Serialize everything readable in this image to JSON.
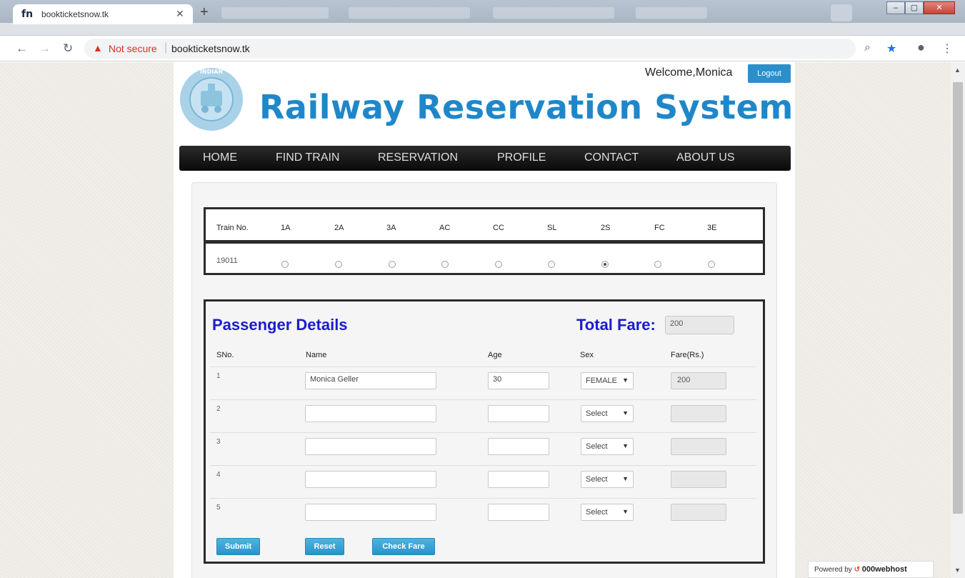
{
  "browser": {
    "tab_title": "bookticketsnow.tk",
    "tab_favicon": "fn",
    "not_secure": "Not secure",
    "url": "bookticketsnow.tk"
  },
  "header": {
    "welcome": "Welcome,Monica",
    "logout": "Logout",
    "title": "Railway Reservation System",
    "logo_text": "INDIAN RAILWAYS"
  },
  "nav": [
    "HOME",
    "FIND TRAIN",
    "RESERVATION",
    "PROFILE",
    "CONTACT",
    "ABOUT US"
  ],
  "train_table": {
    "headers": [
      "Train No.",
      "1A",
      "2A",
      "3A",
      "AC",
      "CC",
      "SL",
      "2S",
      "FC",
      "3E"
    ],
    "train_no": "19011",
    "selected_class": "2S"
  },
  "passenger": {
    "title": "Passenger Details",
    "total_fare_label": "Total Fare:",
    "total_fare": "200",
    "columns": [
      "SNo.",
      "Name",
      "Age",
      "Sex",
      "Fare(Rs.)"
    ],
    "rows": [
      {
        "sno": "1",
        "name": "Monica Geller",
        "age": "30",
        "sex": "FEMALE",
        "fare": "200"
      },
      {
        "sno": "2",
        "name": "",
        "age": "",
        "sex": "Select",
        "fare": ""
      },
      {
        "sno": "3",
        "name": "",
        "age": "",
        "sex": "Select",
        "fare": ""
      },
      {
        "sno": "4",
        "name": "",
        "age": "",
        "sex": "Select",
        "fare": ""
      },
      {
        "sno": "5",
        "name": "",
        "age": "",
        "sex": "Select",
        "fare": ""
      }
    ],
    "buttons": {
      "submit": "Submit",
      "reset": "Reset",
      "check_fare": "Check Fare"
    }
  },
  "footer": {
    "powered_by": "Powered by",
    "brand": "000webhost"
  },
  "colors": {
    "title_blue": "#1f87c9",
    "section_blue": "#1c1ccf",
    "button_blue": "#2d8fc9",
    "nav_dark": "#111111"
  }
}
